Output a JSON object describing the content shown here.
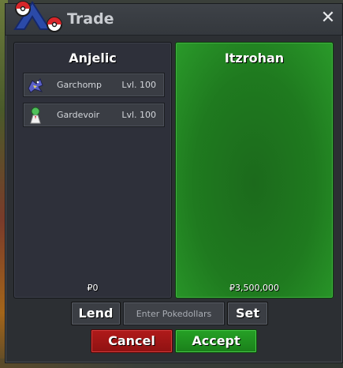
{
  "window": {
    "title": "Trade",
    "close_icon": "close-icon"
  },
  "left_panel": {
    "name": "Anjelic",
    "money": "₽0",
    "items": [
      {
        "name": "Garchomp",
        "level": "Lvl. 100",
        "icon": "garchomp-icon"
      },
      {
        "name": "Gardevoir",
        "level": "Lvl. 100",
        "icon": "gardevoir-icon"
      }
    ]
  },
  "right_panel": {
    "name": "Itzrohan",
    "money": "₽3,500,000"
  },
  "controls": {
    "lend_label": "Lend",
    "money_placeholder": "Enter Pokedollars",
    "set_label": "Set",
    "cancel_label": "Cancel",
    "accept_label": "Accept"
  },
  "colors": {
    "accept_green": "#1f7a1f",
    "cancel_red": "#a31616",
    "panel_dark": "#2e303a"
  }
}
